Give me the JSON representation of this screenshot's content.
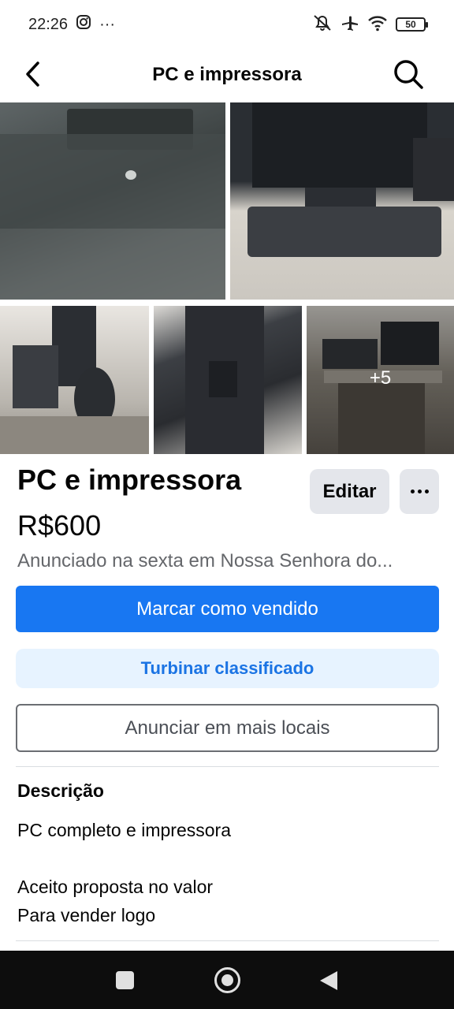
{
  "status_bar": {
    "time": "22:26",
    "more": "···",
    "battery": "50",
    "icons": [
      "instagram-icon",
      "mute-icon",
      "airplane-icon",
      "wifi-icon",
      "battery-icon"
    ]
  },
  "header": {
    "title": "PC e impressora",
    "icons": {
      "back": "back-arrow-icon",
      "search": "search-icon"
    }
  },
  "photos": {
    "count": 5,
    "more_label": "+5"
  },
  "listing": {
    "title": "PC e impressora",
    "price": "R$600",
    "meta": "Anunciado na sexta em Nossa Senhora do...",
    "edit_label": "Editar"
  },
  "actions": {
    "mark_sold": "Marcar como vendido",
    "boost": "Turbinar classificado",
    "list_more": "Anunciar em mais locais"
  },
  "description": {
    "heading": "Descrição",
    "lines": [
      "PC completo e impressora",
      "Aceito proposta no valor",
      "Para vender logo"
    ]
  },
  "colors": {
    "primary": "#1877f2",
    "boost_bg": "#e7f3ff",
    "boost_text": "#1b74e4",
    "secondary_btn": "#e4e6eb",
    "muted_text": "#65676b"
  }
}
